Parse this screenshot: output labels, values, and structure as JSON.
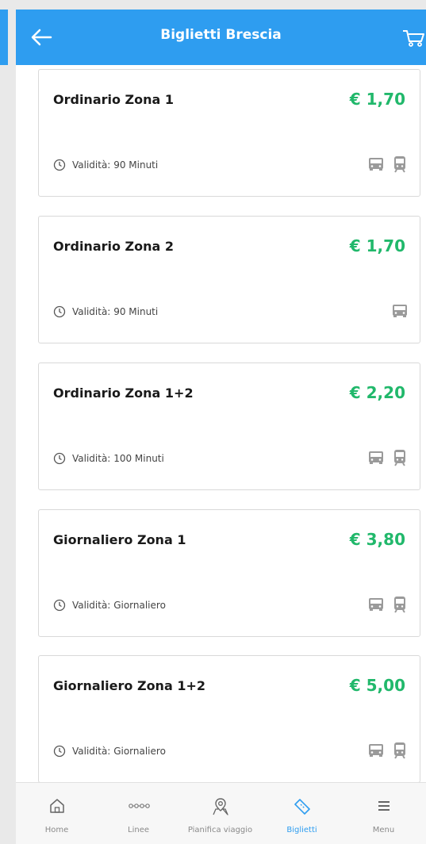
{
  "header": {
    "title": "Biglietti Brescia",
    "back_icon": "arrow-left-icon",
    "cart_icon": "cart-icon",
    "color": "#2e9df0"
  },
  "tickets": [
    {
      "name": "Ordinario Zona 1",
      "price": "€ 1,70",
      "validity_label": "Validità:",
      "validity_value": "90 Minuti",
      "modes": [
        "bus-icon",
        "tram-icon"
      ]
    },
    {
      "name": "Ordinario Zona 2",
      "price": "€ 1,70",
      "validity_label": "Validità:",
      "validity_value": "90 Minuti",
      "modes": [
        "bus-icon"
      ]
    },
    {
      "name": "Ordinario Zona 1+2",
      "price": "€ 2,20",
      "validity_label": "Validità:",
      "validity_value": "100 Minuti",
      "modes": [
        "bus-icon",
        "tram-icon"
      ]
    },
    {
      "name": "Giornaliero Zona 1",
      "price": "€ 3,80",
      "validity_label": "Validità:",
      "validity_value": "Giornaliero",
      "modes": [
        "bus-icon",
        "tram-icon"
      ]
    },
    {
      "name": "Giornaliero Zona 1+2",
      "price": "€ 5,00",
      "validity_label": "Validità:",
      "validity_value": "Giornaliero",
      "modes": [
        "bus-icon",
        "tram-icon"
      ]
    }
  ],
  "colors": {
    "price": "#21b86b",
    "accent": "#2e9df0"
  },
  "nav": [
    {
      "label": "Home",
      "icon": "home-icon"
    },
    {
      "label": "Linee",
      "icon": "lines-icon"
    },
    {
      "label": "Pianifica viaggio",
      "icon": "map-pin-icon"
    },
    {
      "label": "Biglietti",
      "icon": "ticket-icon",
      "active": true
    },
    {
      "label": "Menu",
      "icon": "menu-icon"
    }
  ]
}
